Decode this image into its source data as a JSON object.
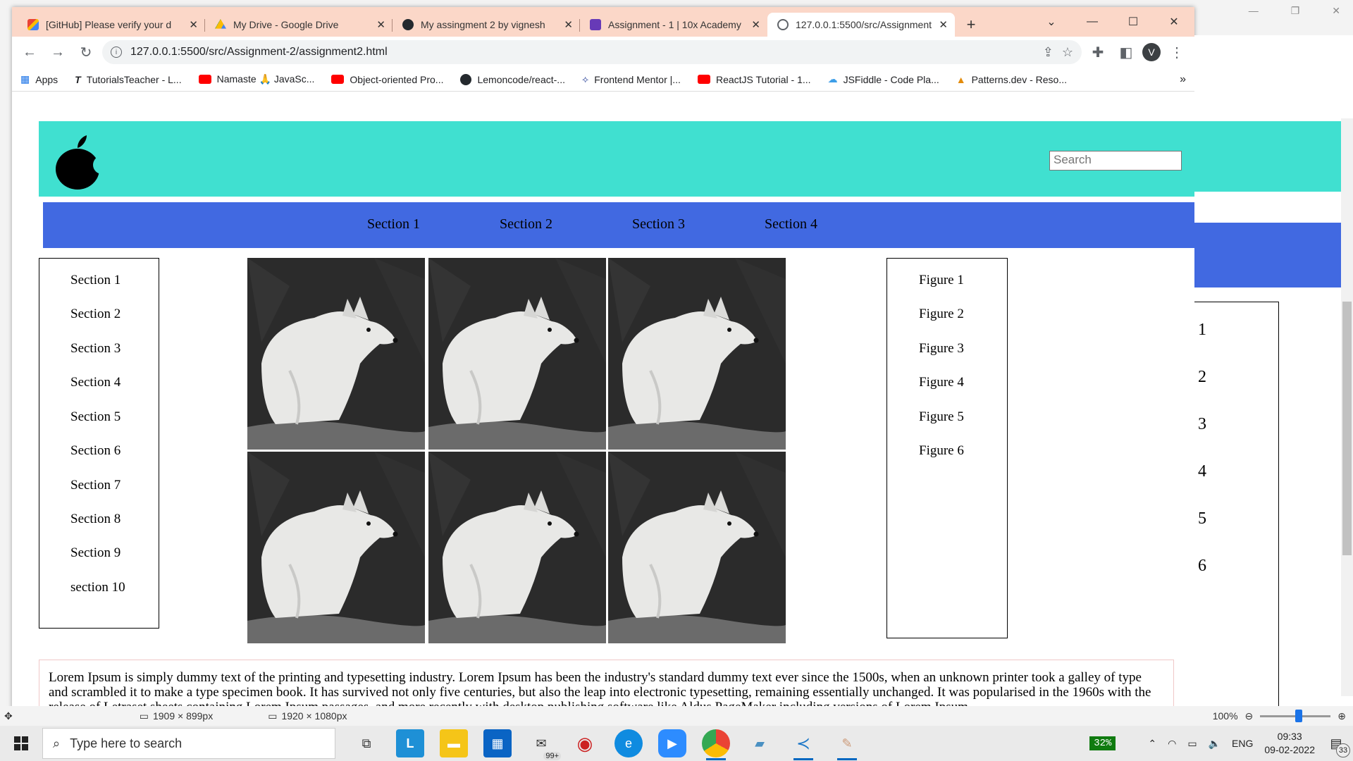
{
  "browser": {
    "tabs": [
      {
        "title": "[GitHub] Please verify your d",
        "icon": "gmail-icon",
        "color": "#d93025"
      },
      {
        "title": "My Drive - Google Drive",
        "icon": "google-drive-icon",
        "color": "#188038"
      },
      {
        "title": "My assingment 2 by vignesh",
        "icon": "github-icon",
        "color": "#24292e"
      },
      {
        "title": "Assignment - 1 | 10x Academy",
        "icon": "forms-icon",
        "color": "#673ab7"
      },
      {
        "title": "127.0.0.1:5500/src/Assignment",
        "icon": "globe-icon",
        "color": "#5f6368"
      }
    ],
    "address": "127.0.0.1:5500/src/Assignment-2/assignment2.html",
    "profile_initial": "V",
    "bookmarks": [
      {
        "label": "Apps",
        "icon": "apps-grid-icon"
      },
      {
        "label": "TutorialsTeacher - L...",
        "icon": "tutorialsteacher-icon"
      },
      {
        "label": "Namaste 🙏 JavaSc...",
        "icon": "youtube-icon"
      },
      {
        "label": "Object-oriented Pro...",
        "icon": "youtube-icon"
      },
      {
        "label": "Lemoncode/react-...",
        "icon": "github-icon"
      },
      {
        "label": "Frontend Mentor |...",
        "icon": "frontendmentor-icon"
      },
      {
        "label": "ReactJS Tutorial - 1...",
        "icon": "youtube-icon"
      },
      {
        "label": "JSFiddle - Code Pla...",
        "icon": "jsfiddle-icon"
      },
      {
        "label": "Patterns.dev - Reso...",
        "icon": "patterns-icon"
      }
    ],
    "bookmarks_more": "»"
  },
  "page": {
    "search_placeholder": "Search",
    "nav": [
      "Section 1",
      "Section 2",
      "Section 3",
      "Section 4"
    ],
    "sidebar": [
      "Section 1",
      "Section 2",
      "Section 3",
      "Section 4",
      "Section 5",
      "Section 6",
      "Section 7",
      "Section 8",
      "Section 9",
      "section 10"
    ],
    "figures": [
      "Figure 1",
      "Figure 2",
      "Figure 3",
      "Figure 4",
      "Figure 5",
      "Figure 6"
    ],
    "image_count": 6,
    "lorem": "Lorem Ipsum is simply dummy text of the printing and typesetting industry. Lorem Ipsum has been the industry's standard dummy text ever since the 1500s, when an unknown printer took a galley of type and scrambled it to make a type specimen book. It has survived not only five centuries, but also the leap into electronic typesetting, remaining essentially unchanged. It was popularised in the 1960s with the release of Letraset sheets containing Lorem Ipsum passages, and more recently with desktop publishing software like Aldus PageMaker including versions of Lorem Ipsum.",
    "colors": {
      "header": "#40e0d0",
      "nav": "#4169e1"
    }
  },
  "right_app": {
    "numbers": [
      "1",
      "2",
      "3",
      "4",
      "5",
      "6"
    ]
  },
  "viewer_status": {
    "dim1": "1909 × 899px",
    "dim2": "1920 × 1080px",
    "zoom": "100%"
  },
  "taskbar": {
    "search_placeholder": "Type here to search",
    "mail_badge": "99+",
    "battery": "32%",
    "language": "ENG",
    "time": "09:33",
    "date": "09-02-2022",
    "notif_count": "33"
  }
}
